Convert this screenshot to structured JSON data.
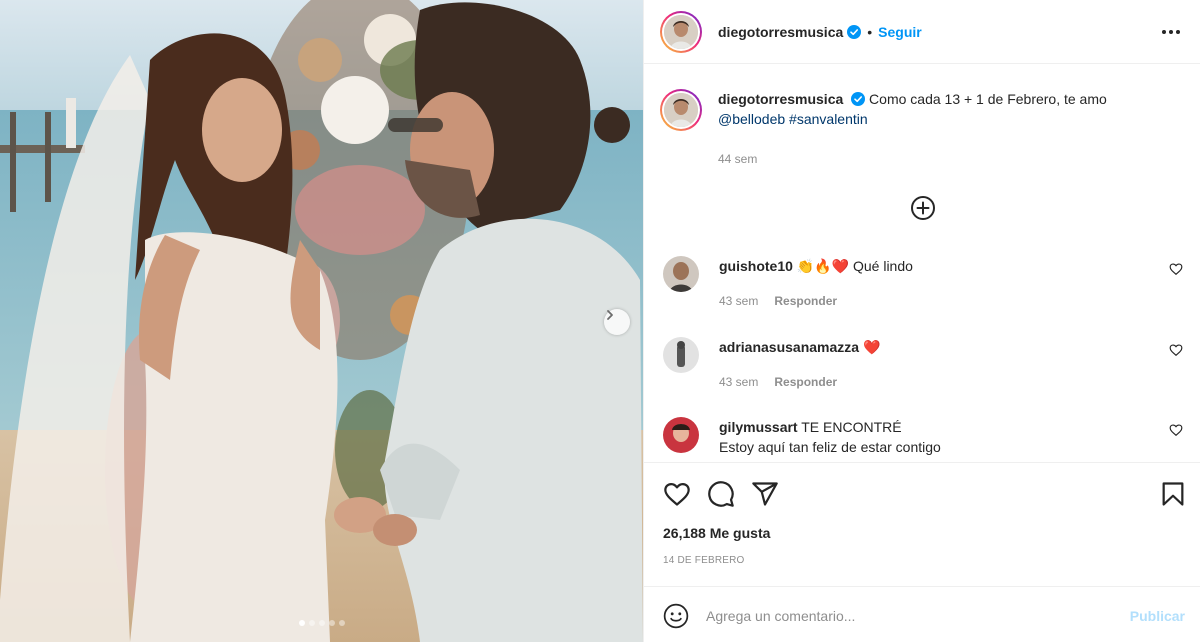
{
  "post": {
    "photo_alt": "",
    "carousel": {
      "slide_count": 5,
      "active_index": 0
    }
  },
  "header": {
    "username": "diegotorresmusica",
    "separator": "•",
    "follow_label": "Seguir",
    "verified_icon": "verified-badge-icon",
    "more_icon": "more-options-icon"
  },
  "caption": {
    "username": "diegotorresmusica",
    "text": "Como cada 13 + 1 de Febrero, te amo",
    "mention": "@bellodeb",
    "hashtag": "#sanvalentin",
    "time": "44 sem"
  },
  "load_more_icon": "plus-circle-icon",
  "comments": [
    {
      "username": "guishote10",
      "text": "👏🔥❤️ Qué lindo",
      "time": "43 sem",
      "reply_label": "Responder"
    },
    {
      "username": "adrianasusanamazza",
      "text": "❤️",
      "time": "43 sem",
      "reply_label": "Responder"
    },
    {
      "username": "gilymussart",
      "text": "TE ENCONTRÉ",
      "text2": "Estoy aquí tan feliz de estar contigo"
    }
  ],
  "actions": {
    "like_icon": "heart-icon",
    "comment_icon": "comment-icon",
    "share_icon": "share-icon",
    "save_icon": "bookmark-icon"
  },
  "likes": {
    "count_text": "26,188 Me gusta"
  },
  "date": "14 de febrero",
  "add_comment": {
    "emoji_icon": "emoji-icon",
    "placeholder": "Agrega un comentario...",
    "publish_label": "Publicar"
  },
  "colors": {
    "accent": "#0095f6",
    "text": "#262626",
    "secondary": "#8e8e8e",
    "border": "#efefef",
    "heart_red": "#ed4956",
    "publish_disabled": "#b2dffc"
  }
}
